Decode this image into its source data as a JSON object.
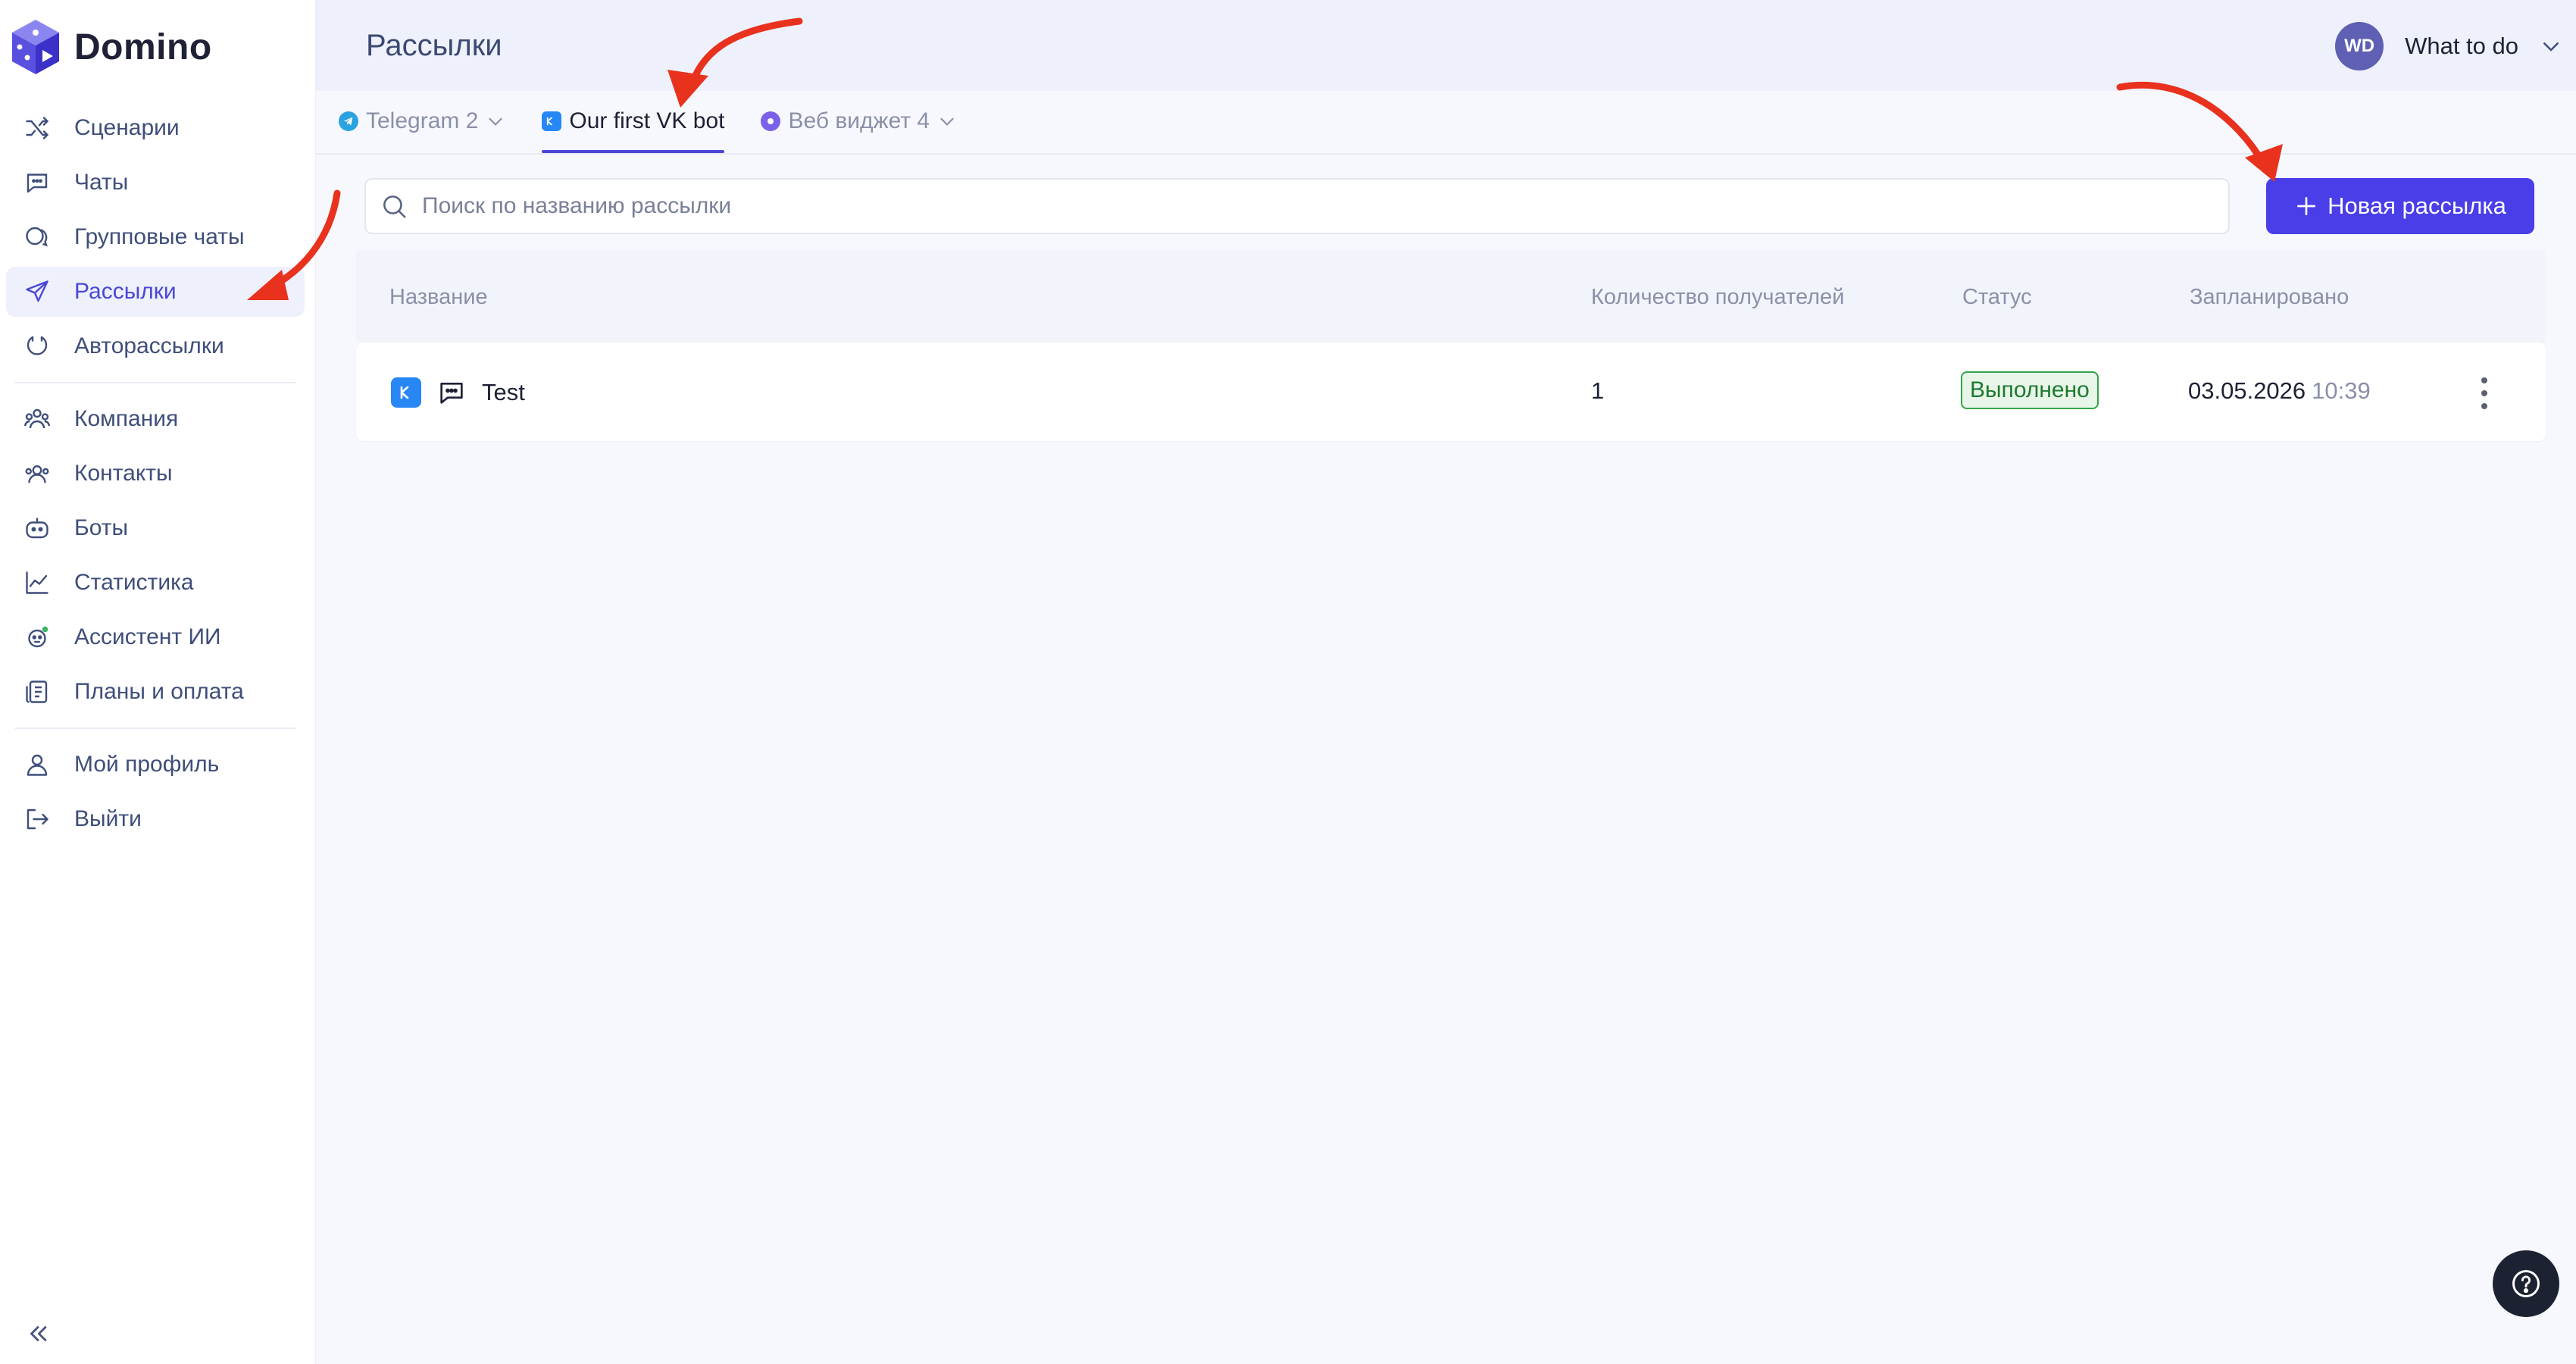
{
  "app": {
    "name": "Domino"
  },
  "sidebar": {
    "items": [
      {
        "label": "Сценарии",
        "icon": "shuffle-icon"
      },
      {
        "label": "Чаты",
        "icon": "chat-icon"
      },
      {
        "label": "Групповые чаты",
        "icon": "group-chat-icon"
      },
      {
        "label": "Рассылки",
        "icon": "send-icon",
        "active": true
      },
      {
        "label": "Авторассылки",
        "icon": "auto-send-icon"
      },
      {
        "label": "Компания",
        "icon": "company-icon"
      },
      {
        "label": "Контакты",
        "icon": "contacts-icon"
      },
      {
        "label": "Боты",
        "icon": "bot-icon"
      },
      {
        "label": "Статистика",
        "icon": "chart-icon"
      },
      {
        "label": "Ассистент ИИ",
        "icon": "ai-assistant-icon"
      },
      {
        "label": "Планы и оплата",
        "icon": "billing-icon"
      },
      {
        "label": "Мой профиль",
        "icon": "profile-icon"
      },
      {
        "label": "Выйти",
        "icon": "logout-icon"
      }
    ]
  },
  "header": {
    "title": "Рассылки",
    "user": {
      "initials": "WD",
      "name": "What to do"
    }
  },
  "tabs": [
    {
      "label": "Telegram 2",
      "icon": "telegram-icon",
      "dropdown": true
    },
    {
      "label": "Our first VK bot",
      "icon": "vk-icon",
      "active": true
    },
    {
      "label": "Веб виджет 4",
      "icon": "web-widget-icon",
      "dropdown": true
    }
  ],
  "search": {
    "placeholder": "Поиск по названию рассылки",
    "value": ""
  },
  "new_button": {
    "label": "Новая рассылка"
  },
  "table": {
    "columns": [
      "Название",
      "Количество получателей",
      "Статус",
      "Запланировано"
    ],
    "rows": [
      {
        "channel_badge": "VK",
        "name": "Test",
        "recipients": "1",
        "status": "Выполнено",
        "date": "03.05.2026",
        "time": "10:39"
      }
    ]
  },
  "colors": {
    "accent": "#4a3ee8",
    "active_nav": "#4a47d8",
    "status_done": "#34a34a",
    "annotation_arrow": "#e8321e"
  }
}
